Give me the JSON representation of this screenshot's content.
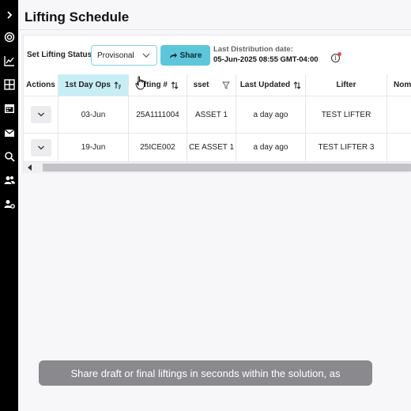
{
  "app": {
    "title": "Lifting Schedule"
  },
  "rail": {
    "icons": [
      "chevron-right-icon",
      "target-icon",
      "chart-line-icon",
      "grid-icon",
      "calendar-icon",
      "mail-icon",
      "search-icon",
      "users-icon",
      "user-settings-icon"
    ]
  },
  "toolbar": {
    "status_label": "Set Lifting Status",
    "status_value": "Provisonal",
    "share_label": "Share",
    "distribution_label": "Last Distribution date:",
    "distribution_value": "05-Jun-2025 08:55 GMT-04:00"
  },
  "table": {
    "columns": [
      "Actions",
      "1st Day Ops",
      "Lifting #",
      "sset",
      "Last Updated",
      "Lifter",
      "Nom"
    ],
    "rows": [
      {
        "day": "03-Jun",
        "lifting": "25A1111004",
        "asset": "ASSET 1",
        "updated": "a day ago",
        "lifter": "TEST LIFTER"
      },
      {
        "day": "19-Jun",
        "lifting": "25ICE002",
        "asset": "CE ASSET 1",
        "updated": "a day ago",
        "lifter": "TEST LIFTER 3"
      }
    ]
  },
  "caption": "Share draft or final liftings in seconds within the solution, as",
  "colors": {
    "accent": "#5ec6da",
    "highlight": "#c8eef5",
    "rail": "#000000"
  }
}
